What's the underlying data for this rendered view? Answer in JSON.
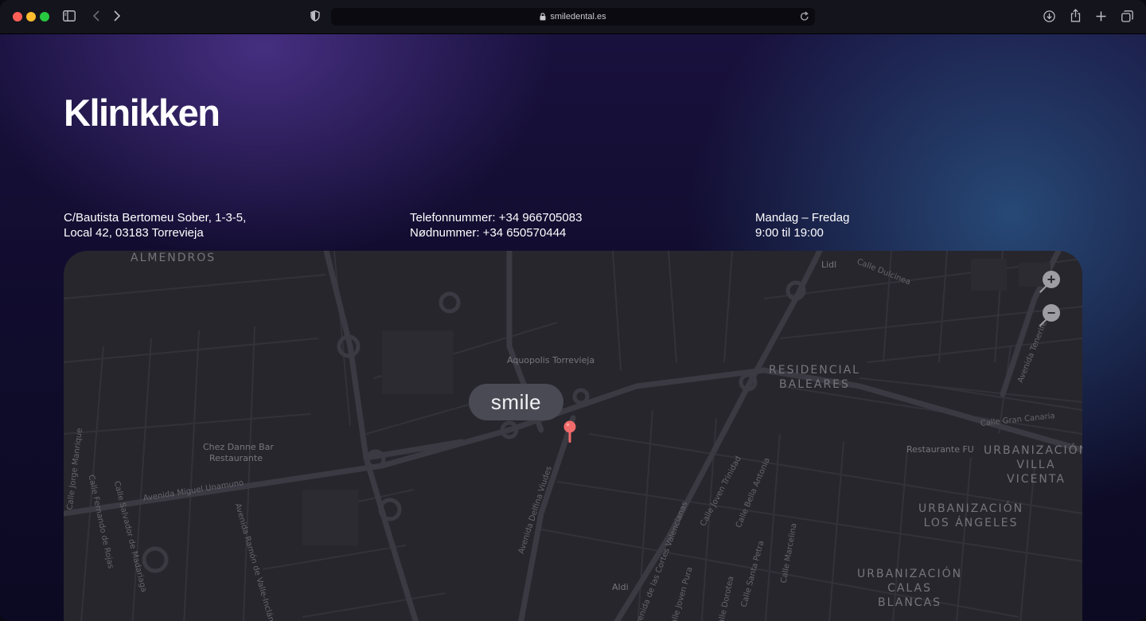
{
  "browser": {
    "url": "smiledental.es",
    "icons": {
      "sidebar": "sidebar-icon",
      "back": "chevron-left-icon",
      "forward": "chevron-right-icon",
      "privacy": "shield-icon",
      "lock": "lock-icon",
      "reload": "reload-icon",
      "download": "download-icon",
      "share": "share-icon",
      "new_tab": "plus-icon",
      "tabs": "tabs-overview-icon"
    }
  },
  "page": {
    "title": "Klinikken",
    "address": {
      "line1": "C/Bautista Bertomeu Sober, 1-3-5,",
      "line2": "Local 42, 03183 Torrevieja"
    },
    "phone": {
      "line1": "Telefonnummer: +34 966705083",
      "line2": "Nødnummer: +34 650570444"
    },
    "hours": {
      "line1": "Mandag – Fredag",
      "line2": "9:00 til 19:00"
    }
  },
  "map": {
    "marker_label": "smile",
    "zoom_in": "+",
    "zoom_out": "−",
    "areas": {
      "almendros": "ALMENDROS",
      "baleares": "RESIDENCIAL\nBALEARES",
      "villa_vicenta": "URBANIZACIÓN\nVILLA\nVICENTA",
      "los_angeles": "URBANIZACIÓN\nLOS ÁNGELES",
      "calas_blancas": "URBANIZACIÓN\nCALAS\nBLANCAS"
    },
    "places": {
      "lidl": "Lidl",
      "aquopolis": "Aquopolis Torrevieja",
      "chez_danne_1": "Chez Danne Bar",
      "chez_danne_2": "Restaurante",
      "restaurante_fu": "Restaurante FU",
      "aldi": "Aldi"
    },
    "streets": {
      "dulcinea": "Calle Dulcinea",
      "gran_canaria": "Calle Gran Canaria",
      "tenerife": "Avenida Tenerife",
      "miguel_unamuno": "Avenida Miguel Unamuno",
      "delfina_viudes": "Avenida Delfina Viudes",
      "jorge_manrique": "Calle Jorge Manrique",
      "fernando_rojas": "Calle Fernando de Rojas",
      "salvador_madariaga": "Calle Salvador de Madariaga",
      "ramon_valle": "Avenida Ramón de Valle-Inclán",
      "cortes_valencianas": "Avenida de las Cortes Valencianas",
      "joven_trinidad": "Calle Joven Trinidad",
      "bella_antonia": "Calle Bella Antonia",
      "santa_petra": "Calle Santa Petra",
      "marcelina": "Calle Marcelina",
      "dorotea": "Calle Dorotea",
      "joven_pura": "Calle Joven Pura"
    }
  },
  "colors": {
    "pin": "#f06b6b",
    "map_background": "#27262d",
    "road": "#393840"
  }
}
